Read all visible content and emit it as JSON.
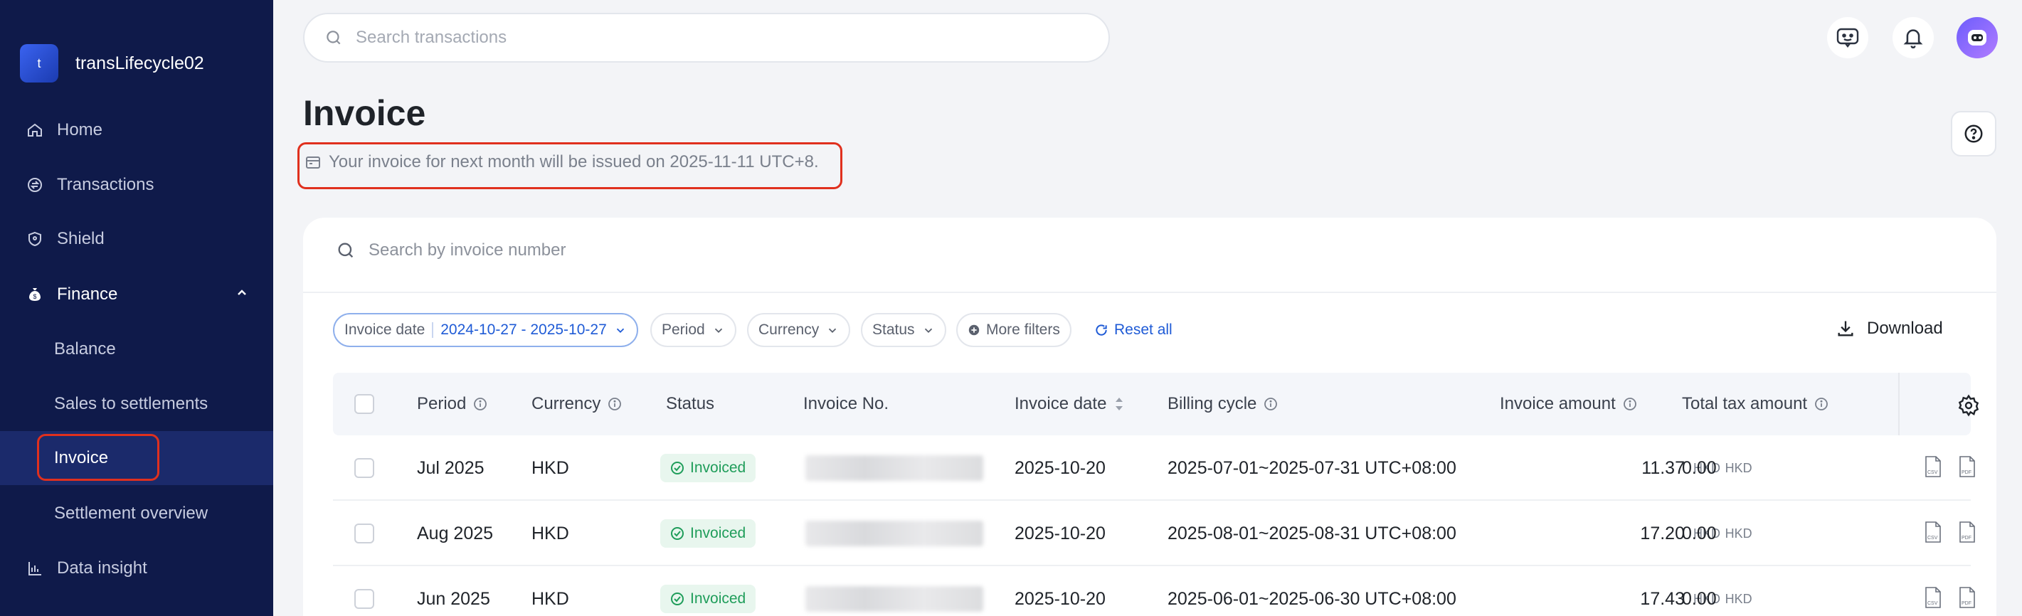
{
  "sidebar": {
    "merchant_initial": "t",
    "merchant_name": "transLifecycle02",
    "items": [
      {
        "label": "Home"
      },
      {
        "label": "Transactions"
      },
      {
        "label": "Shield"
      },
      {
        "label": "Finance"
      },
      {
        "label": "Balance"
      },
      {
        "label": "Sales to settlements"
      },
      {
        "label": "Invoice"
      },
      {
        "label": "Settlement overview"
      },
      {
        "label": "Data insight"
      }
    ],
    "active_item": "Invoice"
  },
  "topbar": {
    "search_placeholder": "Search transactions"
  },
  "page": {
    "title": "Invoice",
    "notice": "Your invoice for next month will be issued on 2025-11-11 UTC+8."
  },
  "invoice_search": {
    "placeholder": "Search by invoice number"
  },
  "filters": {
    "invoice_date_label": "Invoice date",
    "invoice_date_value": "2024-10-27 - 2025-10-27",
    "period": "Period",
    "currency": "Currency",
    "status": "Status",
    "more_filters": "More filters",
    "reset_all": "Reset all",
    "download": "Download"
  },
  "table": {
    "headers": {
      "period": "Period",
      "currency": "Currency",
      "status": "Status",
      "invoice_no": "Invoice No.",
      "invoice_date": "Invoice date",
      "billing_cycle": "Billing cycle",
      "invoice_amount": "Invoice amount",
      "total_tax_amount": "Total tax amount"
    },
    "rows": [
      {
        "period": "Jul 2025",
        "currency": "HKD",
        "status": "Invoiced",
        "invoice_date": "2025-10-20",
        "billing_cycle": "2025-07-01~2025-07-31 UTC+08:00",
        "invoice_amount": "11.37",
        "invoice_ccy": "HKD",
        "tax_amount": "0.00",
        "tax_ccy": "HKD"
      },
      {
        "period": "Aug 2025",
        "currency": "HKD",
        "status": "Invoiced",
        "invoice_date": "2025-10-20",
        "billing_cycle": "2025-08-01~2025-08-31 UTC+08:00",
        "invoice_amount": "17.20",
        "invoice_ccy": "HKD",
        "tax_amount": "0.00",
        "tax_ccy": "HKD"
      },
      {
        "period": "Jun 2025",
        "currency": "HKD",
        "status": "Invoiced",
        "invoice_date": "2025-10-20",
        "billing_cycle": "2025-06-01~2025-06-30 UTC+08:00",
        "invoice_amount": "17.43",
        "invoice_ccy": "HKD",
        "tax_amount": "0.00",
        "tax_ccy": "HKD"
      }
    ]
  },
  "colors": {
    "sidebar_bg": "#0f1a4a",
    "accent_blue": "#1f5bd6",
    "status_green": "#1f9d5a",
    "highlight_red": "#e0301e"
  }
}
